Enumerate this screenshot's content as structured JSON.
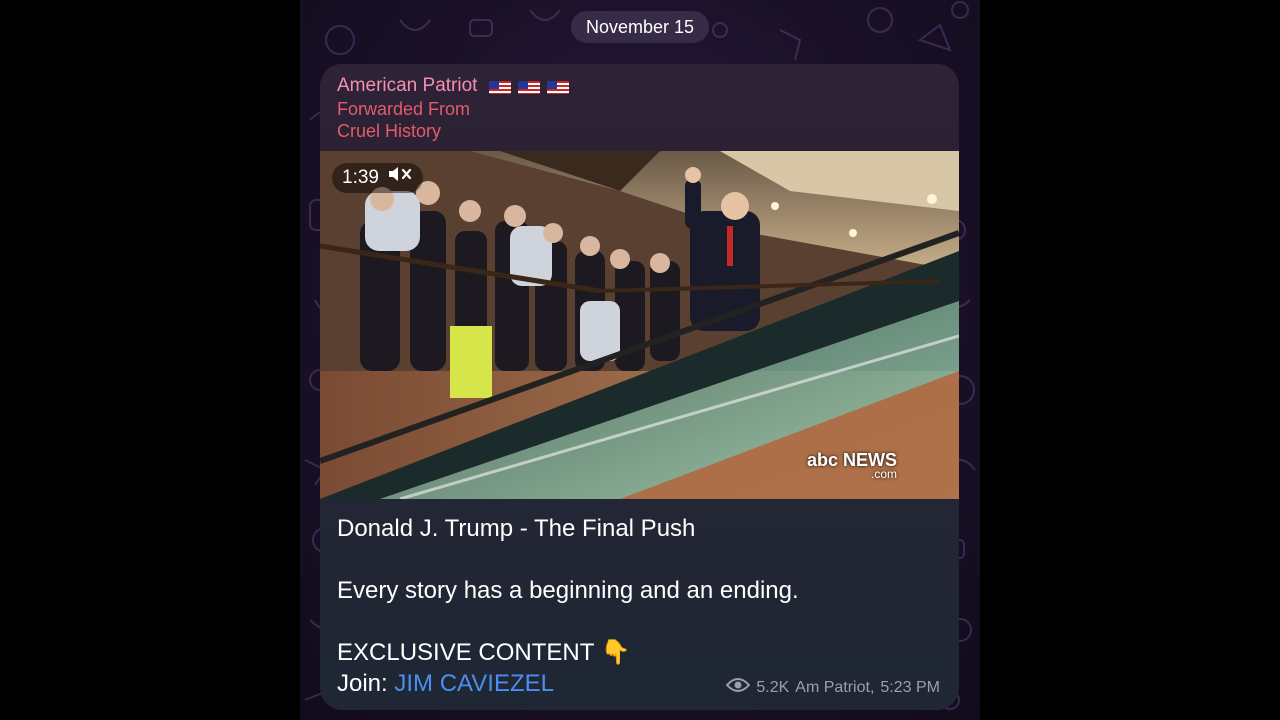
{
  "chat": {
    "date_label": "November 15"
  },
  "message": {
    "sender": "American Patriot",
    "sender_flags": [
      "us-flag-icon",
      "us-flag-icon",
      "us-flag-icon"
    ],
    "forwarded_label": "Forwarded From",
    "forwarded_source": "Cruel History",
    "video": {
      "duration": "1:39",
      "muted_icon": "speaker-muted-icon",
      "watermark_main": "abc NEWS",
      "watermark_sub": ".com"
    },
    "caption": {
      "title": "Donald J. Trump - The Final Push",
      "line2": "Every story has a beginning and an ending.",
      "line3": "EXCLUSIVE CONTENT",
      "line3_emoji": "👇",
      "join_label": "Join: ",
      "join_link": "JIM CAVIEZEL"
    },
    "meta": {
      "views": "5.2K",
      "author": "Am Patriot,",
      "time": "5:23 PM"
    }
  },
  "colors": {
    "sender": "#f48fb1",
    "forwarded": "#e35b6c",
    "link": "#4b8ef0",
    "meta": "#9aa0aa"
  }
}
